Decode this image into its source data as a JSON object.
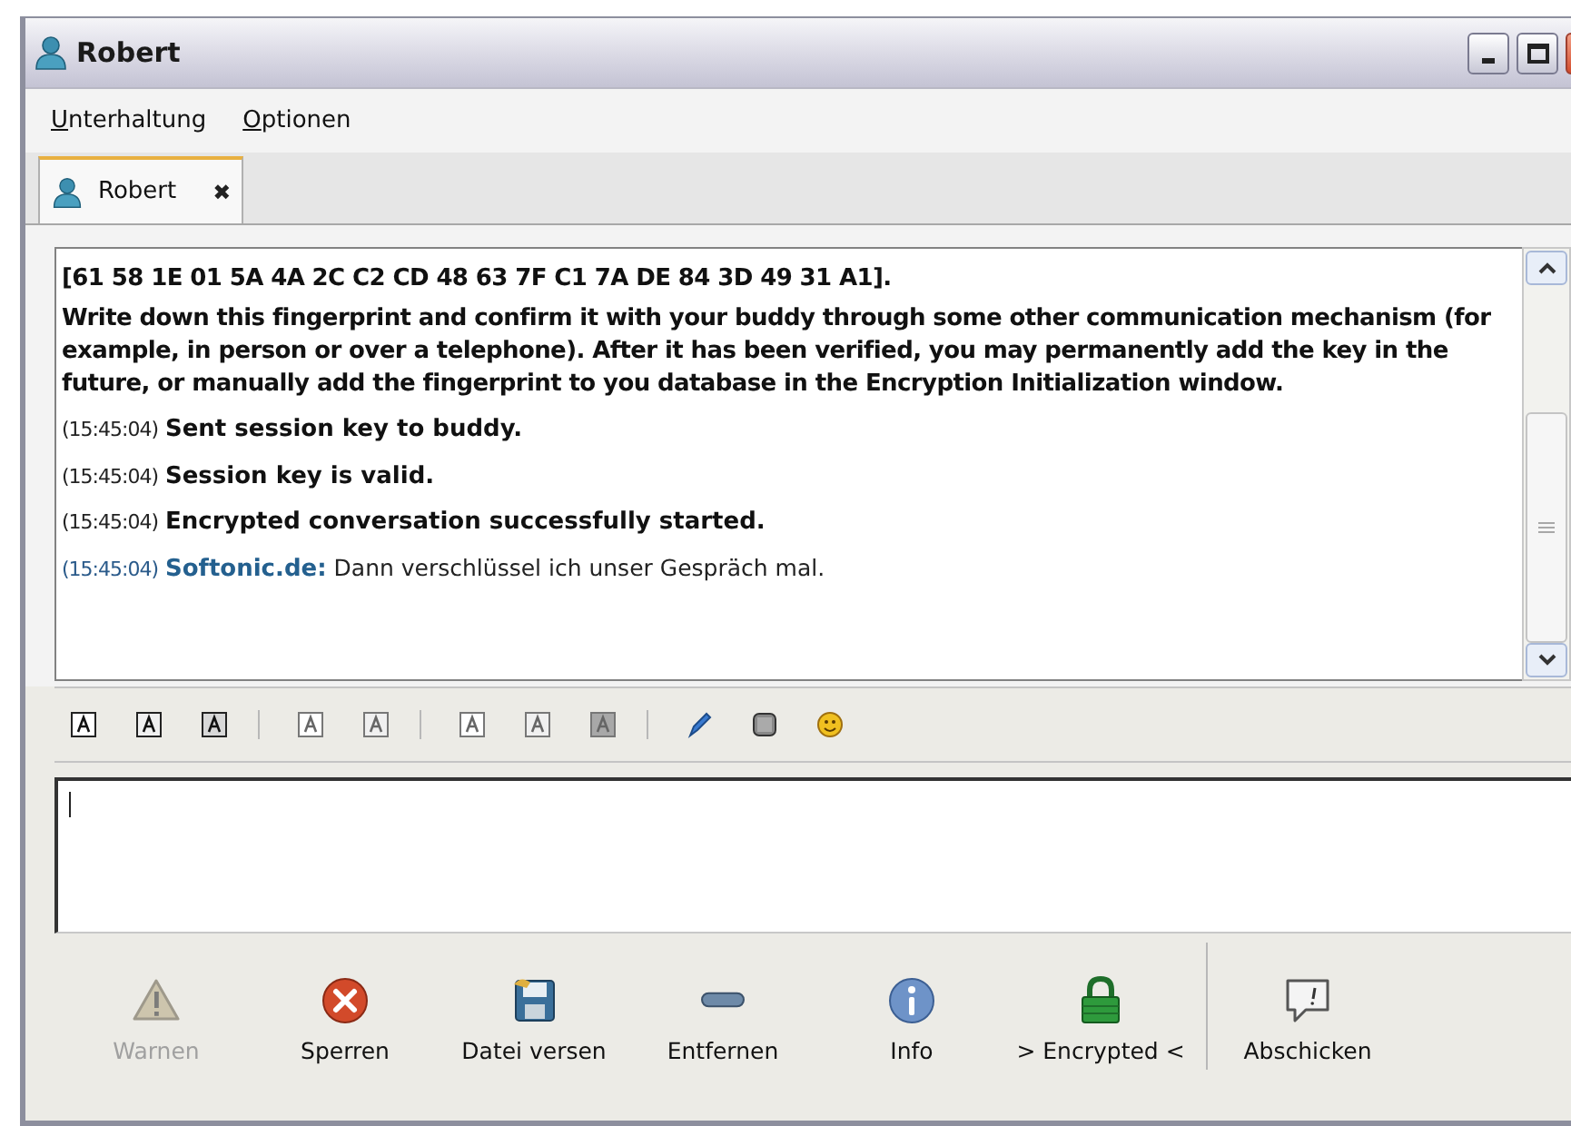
{
  "window": {
    "title": "Robert"
  },
  "menu": [
    {
      "label": "Unterhaltung"
    },
    {
      "label": "Optionen"
    }
  ],
  "tabs": [
    {
      "label": "Robert",
      "selected": true,
      "close": "✖"
    }
  ],
  "messages": [
    {
      "kind": "system",
      "text": "[61 58 1E 01 5A 4A 2C C2 CD 48 63 7F C1 7A DE 84 3D 49 31 A1]."
    },
    {
      "kind": "system",
      "text": "Write down this fingerprint and confirm it with your buddy through some other communication mechanism (for example, in person or over a telephone). After it has been verified, you may permanently add the key in the future, or manually add the fingerprint to you database in the Encryption Initialization window."
    },
    {
      "kind": "status",
      "time": "(15:45:04)",
      "text": "Sent session key to buddy."
    },
    {
      "kind": "status",
      "time": "(15:45:04)",
      "text": "Session key is valid."
    },
    {
      "kind": "status",
      "time": "(15:45:04)",
      "text": "Encrypted conversation successfully started."
    },
    {
      "kind": "chat",
      "time": "(15:45:04)",
      "sender": "Softonic.de:",
      "text": "Dann verschlüssel ich unser Gespräch mal."
    }
  ],
  "actions": [
    {
      "kind": "warning",
      "label": "Warnen",
      "disabled": true
    },
    {
      "kind": "block",
      "label": "Sperren",
      "disabled": false
    },
    {
      "kind": "file",
      "label": "Datei versen",
      "disabled": false
    },
    {
      "kind": "remove",
      "label": "Entfernen",
      "disabled": false
    },
    {
      "kind": "info",
      "label": "Info",
      "disabled": false
    },
    {
      "kind": "lock",
      "label": "> Encrypted <",
      "disabled": false
    },
    {
      "kind": "send",
      "label": "Abschicken",
      "disabled": false
    }
  ]
}
